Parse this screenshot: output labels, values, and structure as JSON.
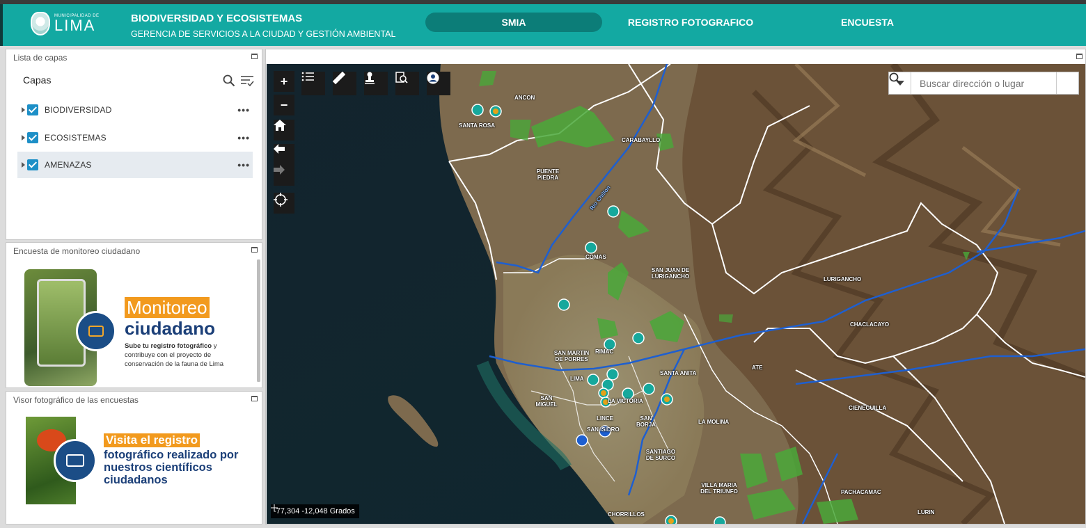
{
  "header": {
    "logo_small": "MUNICIPALIDAD DE",
    "logo_big": "LIMA",
    "title": "BIODIVERSIDAD Y ECOSISTEMAS",
    "subtitle": "GERENCIA DE SERVICIOS A LA CIUDAD Y GESTIÓN AMBIENTAL",
    "nav": [
      "SMIA",
      "REGISTRO FOTOGRAFICO",
      "ENCUESTA"
    ],
    "active_nav": "SMIA",
    "color": "#13a9a2"
  },
  "layers_panel": {
    "title": "Lista de capas",
    "heading": "Capas",
    "items": [
      {
        "label": "BIODIVERSIDAD",
        "checked": true
      },
      {
        "label": "ECOSISTEMAS",
        "checked": true
      },
      {
        "label": "AMENAZAS",
        "checked": true
      }
    ]
  },
  "survey_panel": {
    "title": "Encuesta de monitoreo ciudadano",
    "headline_1": "Monitoreo",
    "headline_2": "ciudadano",
    "body_bold": "Sube tu registro fotográfico",
    "body": "y contribuye con el proyecto de conservación de la fauna de Lima"
  },
  "viewer_panel": {
    "title": "Visor fotográfico de las encuestas",
    "headline_1": "Visita el registro",
    "headline_2": "fotográfico realizado por nuestros científicos ciudadanos"
  },
  "map": {
    "search_placeholder": "Buscar dirección o lugar",
    "coords": "-77,304 -12,048 Grados",
    "district_labels": [
      "ANCON",
      "SANTA ROSA",
      "CARABAYLLO",
      "PUENTE PIEDRA",
      "COMAS",
      "SAN JUAN DE LURIGANCHO",
      "LURIGANCHO",
      "CHACLACAYO",
      "SAN MARTIN DE PORRES",
      "RIMAC",
      "LIMA",
      "SANTA ANITA",
      "ATE",
      "SAN MIGUEL",
      "LA VICTORIA",
      "LINCE",
      "SAN ISIDRO",
      "SAN BORJA",
      "LA MOLINA",
      "CIENEGUILLA",
      "SANTIAGO DE SURCO",
      "VILLA MARIA DEL TRIUNFO",
      "PACHACAMAC",
      "CHORRILLOS",
      "LURIN"
    ],
    "river_label": "Rio Chillon"
  }
}
